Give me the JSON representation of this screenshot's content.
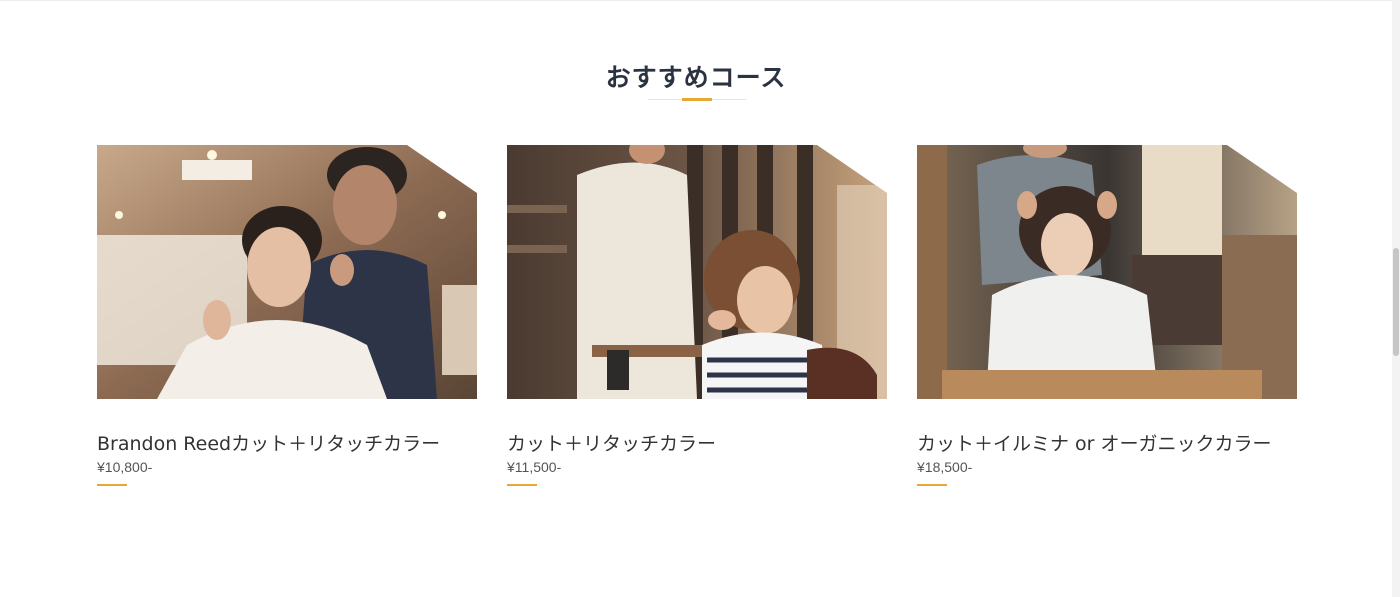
{
  "section": {
    "title": "おすすめコース"
  },
  "colors": {
    "accent": "#e8a838",
    "title_text": "#2b3340",
    "body_text": "#333333"
  },
  "courses": [
    {
      "name": "Brandon Reedカット＋リタッチカラー",
      "price": "¥10,800-",
      "image": "stylist-cutting-smiling-woman-photo"
    },
    {
      "name": "カット＋リタッチカラー",
      "price": "¥11,500-",
      "image": "stylist-styling-woman-hair-photo"
    },
    {
      "name": "カット＋イルミナ or オーガニックカラー",
      "price": "¥18,500-",
      "image": "stylist-combing-woman-hair-photo"
    }
  ]
}
